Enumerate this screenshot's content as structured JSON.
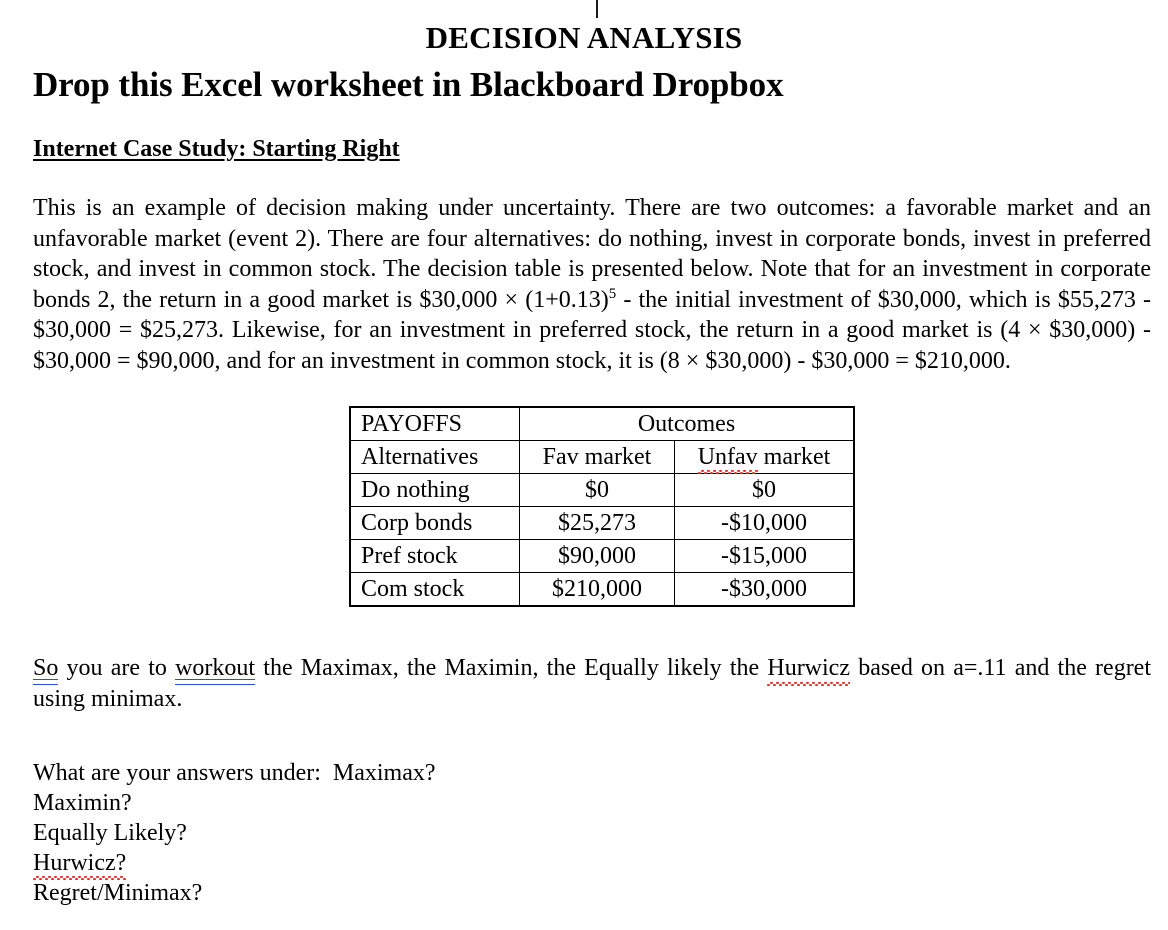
{
  "document": {
    "title": "DECISION ANALYSIS",
    "subtitle": "Drop this Excel worksheet in Blackboard Dropbox",
    "section_heading": "Internet Case Study: Starting Right"
  },
  "intro_paragraph": {
    "seg1": "This is an example of decision making under uncertainty. There are two outcomes: a favorable market and an unfavorable market (event 2). There are four alternatives: do nothing, invest in corporate bonds, invest in preferred stock, and invest in common stock. The decision table is presented below. Note that for an investment in corporate bonds 2, the return in a good market is $30,000 × (1+0.13)",
    "exponent": "5",
    "seg2": " - the initial investment of $30,000, which is $55,273 - $30,000 = $25,273. Likewise, for an investment in preferred stock, the return in a good market is (4 × $30,000) - $30,000 = $90,000, and for an investment in common stock, it is (8 × $30,000) - $30,000 = $210,000."
  },
  "payoff_table": {
    "corner_label": "PAYOFFS",
    "group_header": "Outcomes",
    "row_header_label": "Alternatives",
    "column_headers": [
      "Fav market",
      "Unfav market"
    ],
    "column_header_misspelled_prefix": "Unfav",
    "column_header_misspelled_suffix": " market",
    "rows": [
      {
        "alternative": "Do nothing",
        "fav": "$0",
        "unfav": "$0"
      },
      {
        "alternative": "Corp bonds",
        "fav": "$25,273",
        "unfav": "-$10,000"
      },
      {
        "alternative": "Pref stock",
        "fav": "$90,000",
        "unfav": "-$15,000"
      },
      {
        "alternative": "Com stock",
        "fav": "$210,000",
        "unfav": "-$30,000"
      }
    ]
  },
  "task_paragraph": {
    "so": "So",
    "mid1": " you are to ",
    "workout": "workout",
    "mid2": " the Maximax, the Maximin, the Equally likely the ",
    "hurwicz": "Hurwicz",
    "tail": " based on a=.11 and the regret using minimax."
  },
  "questions": {
    "line1": "What are your answers under:  Maximax?",
    "line2": "Maximin?",
    "line3": "Equally Likely?",
    "line4": "Hurwicz?",
    "line5": "Regret/Minimax?"
  },
  "colors": {
    "text": "#000000",
    "page_background": "#ffffff",
    "spellcheck_underline": "#e03227",
    "grammar_underline": "#2b4fd6",
    "table_border": "#000000"
  }
}
